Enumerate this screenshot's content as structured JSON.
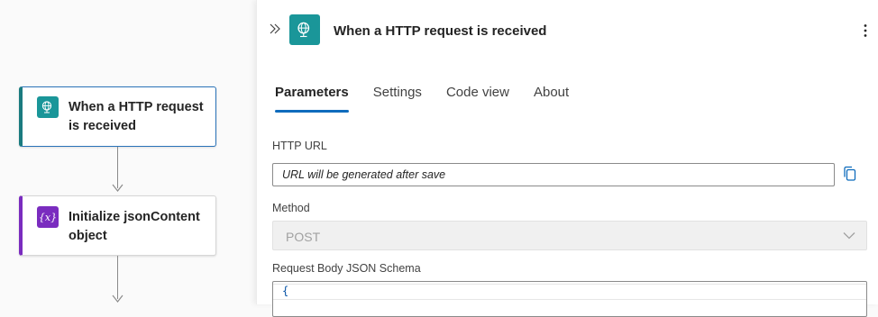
{
  "canvas": {
    "nodes": [
      {
        "title_line1": "When a HTTP request",
        "title_line2": "is received",
        "icon": "globe-request-icon"
      },
      {
        "title_line1": "Initialize jsonContent",
        "title_line2": "object",
        "icon": "variable-icon",
        "icon_text": "{x}"
      }
    ]
  },
  "panel": {
    "title": "When a HTTP request is received",
    "tabs": [
      "Parameters",
      "Settings",
      "Code view",
      "About"
    ],
    "active_tab": "Parameters",
    "http_url": {
      "label": "HTTP URL",
      "value": "URL will be generated after save"
    },
    "method": {
      "label": "Method",
      "value": "POST"
    },
    "schema": {
      "label": "Request Body JSON Schema",
      "first_line": "{"
    }
  },
  "colors": {
    "accent": "#0f6cbd",
    "trigger": "#1a9699",
    "variable": "#7a2cbf"
  }
}
